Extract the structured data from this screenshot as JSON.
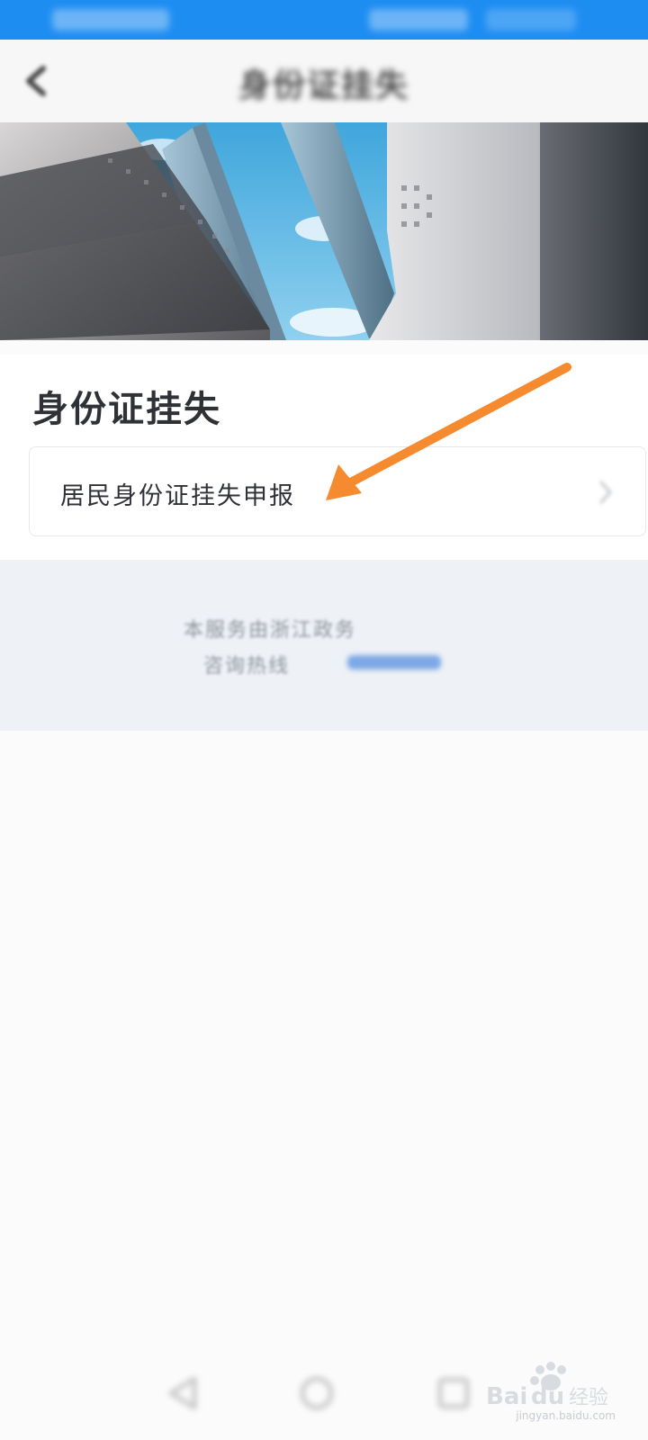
{
  "header": {
    "title": "身份证挂失"
  },
  "section": {
    "title": "身份证挂失",
    "items": [
      {
        "label": "居民身份证挂失申报"
      }
    ]
  },
  "footer": {
    "line1": "本服务由浙江政务",
    "line2": "咨询热线"
  },
  "watermark": {
    "brand": "Baidu经验",
    "url": "jingyan.baidu.com"
  },
  "colors": {
    "status_bar": "#1e8df2",
    "arrow": "#f58a2e",
    "title_text": "#2f3137",
    "footer_bg": "#eef1f6"
  },
  "icons": {
    "back": "chevron-left-icon",
    "item_chevron": "chevron-right-icon",
    "annotation": "orange-arrow-icon",
    "bottom_nav": [
      "back-triangle-icon",
      "home-circle-icon",
      "recents-square-icon"
    ]
  }
}
